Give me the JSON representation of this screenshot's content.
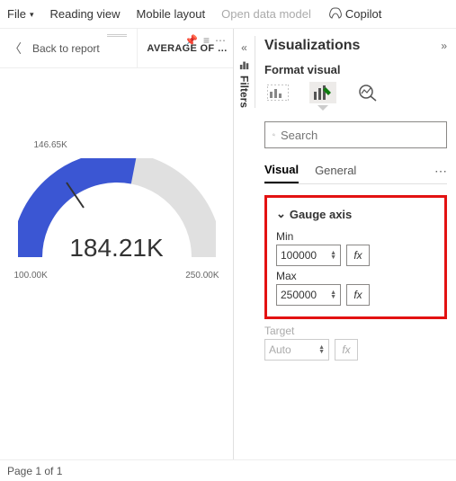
{
  "topbar": {
    "file": "File",
    "reading_view": "Reading view",
    "mobile_layout": "Mobile layout",
    "open_data_model": "Open data model",
    "copilot": "Copilot"
  },
  "viz_header": {
    "back": "Back to report",
    "title": "AVERAGE OF …"
  },
  "filters": {
    "label": "Filters"
  },
  "gauge": {
    "value_label": "184.21K",
    "min_label": "100.00K",
    "max_label": "250.00K",
    "target_label": "146.65K"
  },
  "chart_data": {
    "type": "gauge",
    "value": 184210,
    "min": 100000,
    "max": 250000,
    "target": 146650,
    "title": "AVERAGE OF …"
  },
  "pane": {
    "title": "Visualizations",
    "subtitle": "Format visual",
    "search_placeholder": "Search",
    "tabs": {
      "visual": "Visual",
      "general": "General"
    },
    "section": {
      "title": "Gauge axis",
      "min_label": "Min",
      "min_value": "100000",
      "max_label": "Max",
      "max_value": "250000",
      "target_label": "Target",
      "target_value": "Auto",
      "fx": "fx"
    }
  },
  "footer": {
    "page": "Page 1 of 1"
  },
  "colors": {
    "gauge_fill": "#3b56d3",
    "gauge_track": "#e0e0e0"
  }
}
